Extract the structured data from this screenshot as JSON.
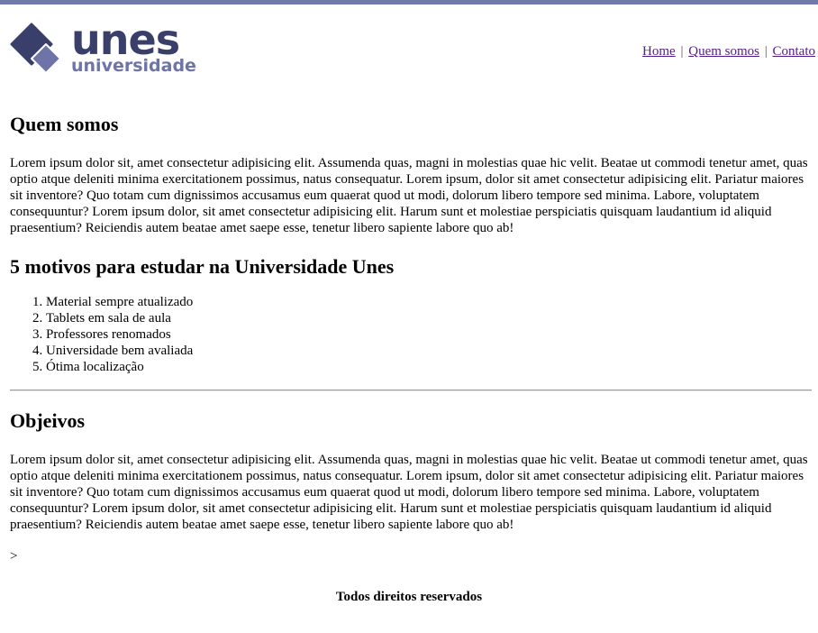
{
  "colors": {
    "top_bar": "#7079a8",
    "logo_dark": "#3a3e6a",
    "logo_light": "#6e74a8",
    "link": "#551a8b"
  },
  "logo": {
    "icon": "diamond-logo-icon",
    "wordmark": "unes",
    "subtitle": "universidade"
  },
  "nav": {
    "home": "Home",
    "sep1": "|",
    "quem_somos": "Quem somos",
    "sep2": "|",
    "contato": "Contato"
  },
  "section1": {
    "title": "Quem somos",
    "text": "Lorem ipsum dolor sit, amet consectetur adipisicing elit. Assumenda quas, magni in molestias quae hic velit. Beatae ut commodi tenetur amet, quas optio atque deleniti minima exercitationem possimus, natus consequatur. Lorem ipsum, dolor sit amet consectetur adipisicing elit. Pariatur maiores sit inventore? Quo totam cum dignissimos accusamus eum quaerat quod ut modi, dolorum libero tempore sed minima. Labore, voluptatem consequuntur? Lorem ipsum dolor, sit amet consectetur adipisicing elit. Harum sunt et molestiae perspiciatis quisquam laudantium id aliquid praesentium? Reiciendis autem beatae amet saepe esse, tenetur libero sapiente labore quo ab!"
  },
  "section2": {
    "title": "5 motivos para estudar na Universidade Unes",
    "items": [
      "Material sempre atualizado",
      "Tablets em sala de aula",
      "Professores renomados",
      "Universidade bem avaliada",
      "Ótima localização"
    ]
  },
  "section3": {
    "title": "Objeivos",
    "text": "Lorem ipsum dolor sit, amet consectetur adipisicing elit. Assumenda quas, magni in molestias quae hic velit. Beatae ut commodi tenetur amet, quas optio atque deleniti minima exercitationem possimus, natus consequatur. Lorem ipsum, dolor sit amet consectetur adipisicing elit. Pariatur maiores sit inventore? Quo totam cum dignissimos accusamus eum quaerat quod ut modi, dolorum libero tempore sed minima. Labore, voluptatem consequuntur? Lorem ipsum dolor, sit amet consectetur adipisicing elit. Harum sunt et molestiae perspiciatis quisquam laudantium id aliquid praesentium? Reiciendis autem beatae amet saepe esse, tenetur libero sapiente labore quo ab!",
    "stray": ">"
  },
  "footer": {
    "text": "Todos direitos reservados"
  }
}
